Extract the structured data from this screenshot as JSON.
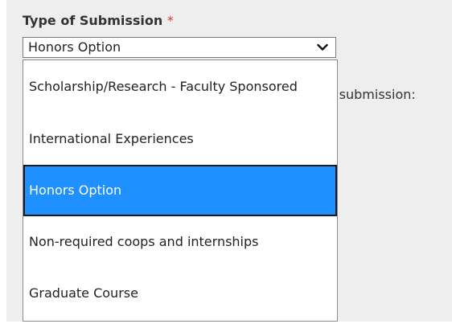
{
  "form": {
    "field_label": "Type of Submission",
    "required_marker": "*",
    "selected_value": "Honors Option",
    "partial_text": "r submission:"
  },
  "dropdown": {
    "options": [
      {
        "label": "Scholarship/Research - Faculty Sponsored",
        "selected": false
      },
      {
        "label": "International Experiences",
        "selected": false
      },
      {
        "label": "Honors Option",
        "selected": true
      },
      {
        "label": "Non-required coops and internships",
        "selected": false
      },
      {
        "label": "Graduate Course",
        "selected": false
      }
    ]
  },
  "icons": {
    "select_arrow": "chevron-down-icon"
  },
  "colors": {
    "highlight": "#1e90ff",
    "required": "#e0393e",
    "panel_background": "#eeeeee"
  }
}
